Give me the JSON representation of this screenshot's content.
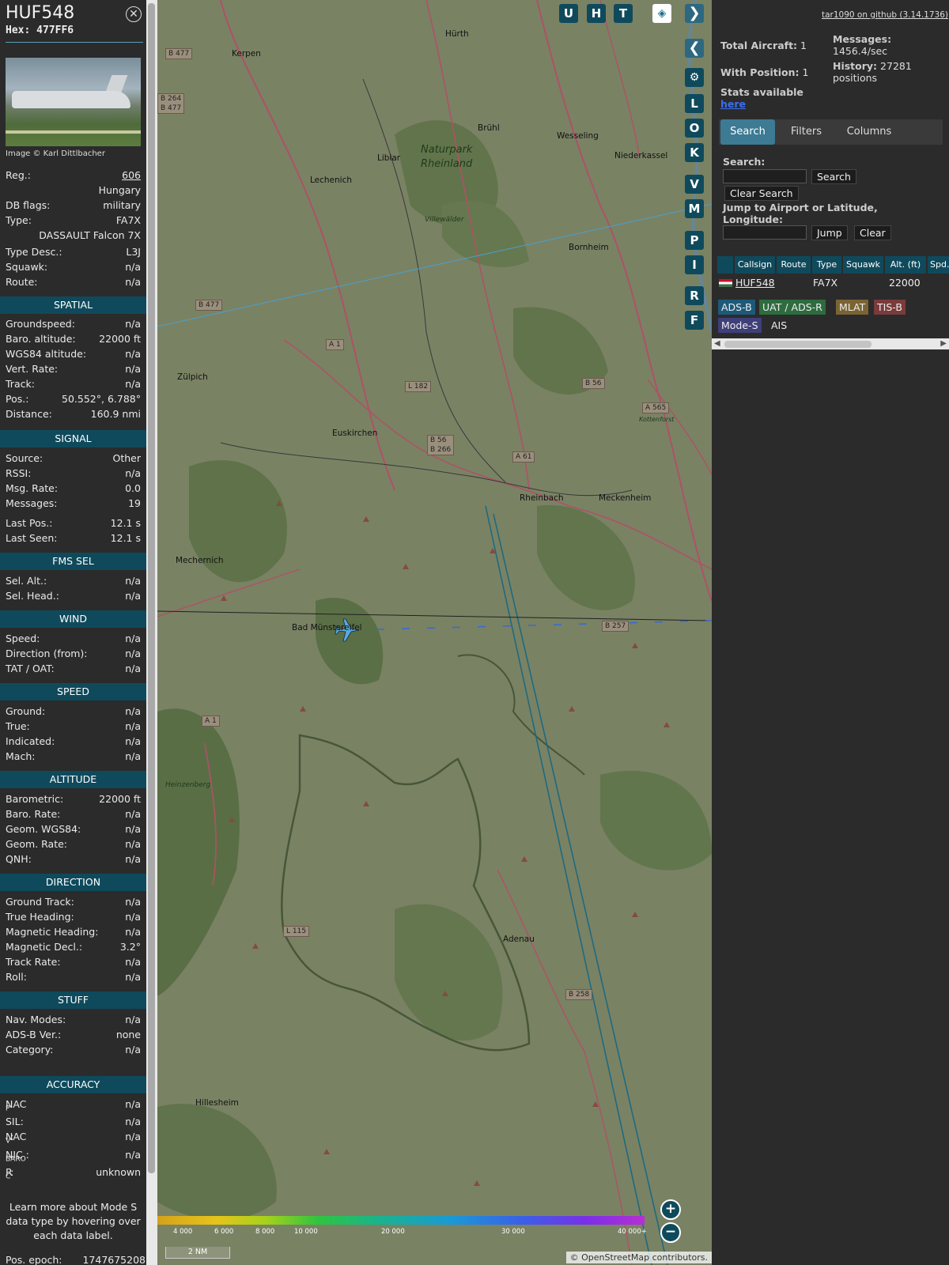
{
  "aircraft": {
    "callsign": "HUF548",
    "hex_label": "Hex:",
    "hex": "477FF6",
    "photo_credit": "Image © Karl Dittlbacher"
  },
  "details": [
    {
      "k": "Reg.:",
      "v": "606"
    },
    {
      "k": "",
      "v": "Hungary"
    },
    {
      "k": "DB flags:",
      "v": "military"
    },
    {
      "k": "Type:",
      "v": "FA7X"
    },
    {
      "k": "",
      "v": "DASSAULT Falcon 7X"
    },
    {
      "k": "Type Desc.:",
      "v": "L3J"
    },
    {
      "k": "Squawk:",
      "v": "n/a"
    },
    {
      "k": "Route:",
      "v": "n/a"
    }
  ],
  "sections": {
    "spatial": {
      "title": "SPATIAL",
      "rows": [
        {
          "k": "Groundspeed:",
          "v": "n/a"
        },
        {
          "k": "Baro. altitude:",
          "v": "22000 ft"
        },
        {
          "k": "WGS84 altitude:",
          "v": "n/a"
        },
        {
          "k": "Vert. Rate:",
          "v": "n/a"
        },
        {
          "k": "Track:",
          "v": "n/a"
        },
        {
          "k": "Pos.:",
          "v": "50.552°, 6.788°"
        },
        {
          "k": "Distance:",
          "v": "160.9 nmi"
        }
      ]
    },
    "signal": {
      "title": "SIGNAL",
      "rows": [
        {
          "k": "Source:",
          "v": "Other"
        },
        {
          "k": "RSSI:",
          "v": "n/a"
        },
        {
          "k": "Msg. Rate:",
          "v": "0.0"
        },
        {
          "k": "Messages:",
          "v": "19"
        },
        {
          "k": "Last Pos.:",
          "v": "12.1 s"
        },
        {
          "k": "Last Seen:",
          "v": "12.1 s"
        }
      ]
    },
    "fms": {
      "title": "FMS SEL",
      "rows": [
        {
          "k": "Sel. Alt.:",
          "v": "n/a"
        },
        {
          "k": "Sel. Head.:",
          "v": "n/a"
        }
      ]
    },
    "wind": {
      "title": "WIND",
      "rows": [
        {
          "k": "Speed:",
          "v": "n/a"
        },
        {
          "k": "Direction (from):",
          "v": "n/a"
        },
        {
          "k": "TAT / OAT:",
          "v": "n/a"
        }
      ]
    },
    "speed": {
      "title": "SPEED",
      "rows": [
        {
          "k": "Ground:",
          "v": "n/a"
        },
        {
          "k": "True:",
          "v": "n/a"
        },
        {
          "k": "Indicated:",
          "v": "n/a"
        },
        {
          "k": "Mach:",
          "v": "n/a"
        }
      ]
    },
    "altitude": {
      "title": "ALTITUDE",
      "rows": [
        {
          "k": "Barometric:",
          "v": "22000 ft"
        },
        {
          "k": "Baro. Rate:",
          "v": "n/a"
        },
        {
          "k": "Geom. WGS84:",
          "v": "n/a"
        },
        {
          "k": "Geom. Rate:",
          "v": "n/a"
        },
        {
          "k": "QNH:",
          "v": "n/a"
        }
      ]
    },
    "direction": {
      "title": "DIRECTION",
      "rows": [
        {
          "k": "Ground Track:",
          "v": "n/a"
        },
        {
          "k": "True Heading:",
          "v": "n/a"
        },
        {
          "k": "Magnetic Heading:",
          "v": "n/a"
        },
        {
          "k": "Magnetic Decl.:",
          "v": "3.2°"
        },
        {
          "k": "Track Rate:",
          "v": "n/a"
        },
        {
          "k": "Roll:",
          "v": "n/a"
        }
      ]
    },
    "stuff": {
      "title": "STUFF",
      "rows": [
        {
          "k": "Nav. Modes:",
          "v": "n/a"
        },
        {
          "k": "ADS-B Ver.:",
          "v": "none"
        },
        {
          "k": "Category:",
          "v": "n/a"
        }
      ]
    },
    "accuracy": {
      "title": "ACCURACY",
      "rows": [
        {
          "k": "NAC",
          "sub": "P",
          "v": "n/a"
        },
        {
          "k": "SIL:",
          "sub": "",
          "v": "n/a"
        },
        {
          "k": "NAC",
          "sub": "V",
          "v": "n/a"
        },
        {
          "k": "NIC",
          "sub": "BARO",
          "v": "n/a"
        },
        {
          "k": "R",
          "sub": "C",
          "v": "unknown"
        }
      ]
    }
  },
  "learn_more": "Learn more about Mode S data type by hovering over each data label.",
  "pos_epoch": {
    "k": "Pos. epoch:",
    "v": "1747675208"
  },
  "map": {
    "buttons": [
      "U",
      "H",
      "T"
    ],
    "side_buttons": [
      "L",
      "O",
      "K",
      "V",
      "M",
      "P",
      "I",
      "R",
      "F"
    ],
    "place_labels": [
      {
        "t": "Hürth",
        "id": "huerth"
      },
      {
        "t": "Kerpen",
        "id": "kerpen"
      },
      {
        "t": "Brühl",
        "id": "bruehl"
      },
      {
        "t": "Wesseling",
        "id": "wesseling"
      },
      {
        "t": "Niederkassel",
        "id": "niederkassel"
      },
      {
        "t": "Liblar",
        "id": "liblar"
      },
      {
        "t": "Lechenich",
        "id": "lechenich"
      },
      {
        "t": "Naturpark",
        "id": "np1"
      },
      {
        "t": "Rheinland",
        "id": "np2"
      },
      {
        "t": "Bornheim",
        "id": "bornheim"
      },
      {
        "t": "Villewälder",
        "id": "villewaelder"
      },
      {
        "t": "Zülpich",
        "id": "zuelpich"
      },
      {
        "t": "Euskirchen",
        "id": "euskirchen"
      },
      {
        "t": "Rheinbach",
        "id": "rheinbach"
      },
      {
        "t": "Meckenheim",
        "id": "meckenheim"
      },
      {
        "t": "Mechernich",
        "id": "mechernich"
      },
      {
        "t": "Bad Münstereifel",
        "id": "badm"
      },
      {
        "t": "Heinzenberg",
        "id": "heinzenberg"
      },
      {
        "t": "Adenau",
        "id": "adenau"
      },
      {
        "t": "Hillesheim",
        "id": "hillesheim"
      },
      {
        "t": "Kottenforst",
        "id": "kottenforst"
      }
    ],
    "road_labels": [
      {
        "t": "B 477",
        "id": "r1"
      },
      {
        "t": "B 264\nB 477",
        "id": "r2"
      },
      {
        "t": "B 477",
        "id": "r3"
      },
      {
        "t": "A 1",
        "id": "r4"
      },
      {
        "t": "L 182",
        "id": "r5"
      },
      {
        "t": "B 56",
        "id": "r6"
      },
      {
        "t": "A 565",
        "id": "r7"
      },
      {
        "t": "B 56\nB 266",
        "id": "r8"
      },
      {
        "t": "A 61",
        "id": "r9"
      },
      {
        "t": "B 257",
        "id": "r10"
      },
      {
        "t": "A 1",
        "id": "r11"
      },
      {
        "t": "L 115",
        "id": "r12"
      },
      {
        "t": "B 258",
        "id": "r13"
      }
    ],
    "legend_ticks": [
      "4 000",
      "6 000",
      "8 000",
      "10 000",
      "20 000",
      "30 000",
      "40 000+"
    ],
    "scale": "2 NM",
    "attribution_prefix": "© ",
    "attribution_link": "OpenStreetMap",
    "attribution_suffix": " contributors."
  },
  "right": {
    "github": "tar1090 on github (3.14.1736)",
    "total_aircraft_label": "Total Aircraft:",
    "total_aircraft": "1",
    "with_position_label": "With Position:",
    "with_position": "1",
    "messages_label": "Messages:",
    "messages_rate": "1456.4/sec",
    "history_label": "History:",
    "history_value": "27281",
    "history_unit": "positions",
    "stats_label": "Stats available",
    "stats_link": "here",
    "tabs": [
      "Search",
      "Filters",
      "Columns"
    ],
    "search_label": "Search:",
    "search_button": "Search",
    "clear_search_button": "Clear Search",
    "jump_label": "Jump to Airport or Latitude, Longitude:",
    "jump_button": "Jump",
    "clear_button": "Clear",
    "columns": [
      "Callsign",
      "Route",
      "Type",
      "Squawk",
      "Alt. (ft)",
      "Spd."
    ],
    "rows": [
      {
        "callsign": "HUF548",
        "route": "",
        "type": "FA7X",
        "squawk": "",
        "alt": "22000",
        "spd": ""
      }
    ],
    "badges": [
      {
        "t": "ADS-B",
        "bg": "#1d5a7a"
      },
      {
        "t": "UAT / ADS-R",
        "bg": "#2e6b3f"
      },
      {
        "t": "MLAT",
        "bg": "#7a6433"
      },
      {
        "t": "TIS-B",
        "bg": "#7a3b3b"
      },
      {
        "t": "Mode-S",
        "bg": "#3f3f7a"
      },
      {
        "t": "AIS",
        "bg": "transparent"
      }
    ]
  },
  "colors": {
    "section_bg": "#0f4a5c",
    "accent": "#3d7a93",
    "track_line": "#1f6f86"
  }
}
